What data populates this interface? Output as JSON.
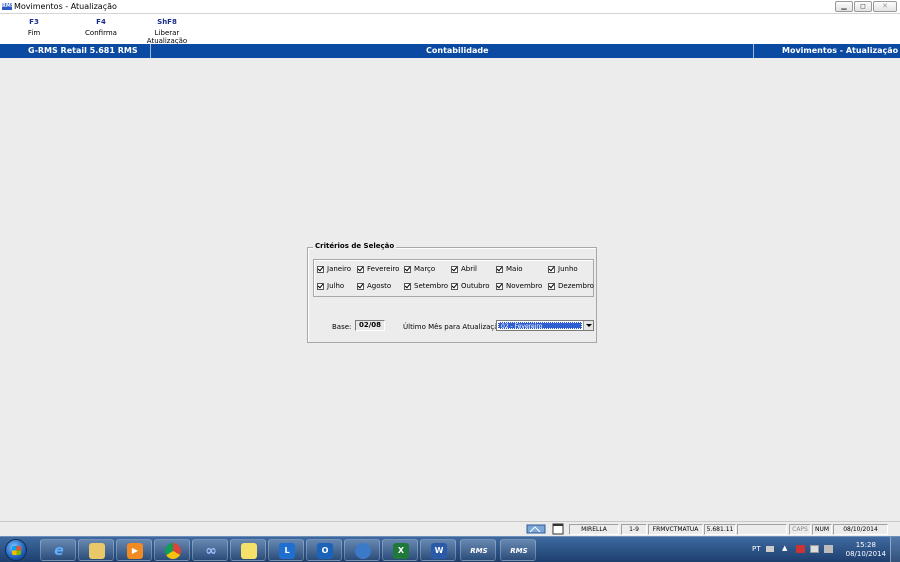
{
  "window": {
    "title": "Movimentos - Atualização",
    "icon_text": "RMS",
    "controls": [
      "minimize",
      "maximize",
      "close"
    ]
  },
  "fkeys": [
    {
      "key": "F3",
      "label": "Fim"
    },
    {
      "key": "F4",
      "label": "Confirma"
    },
    {
      "key": "ShF8",
      "label": "Liberar Atualização"
    }
  ],
  "header": {
    "left": "G-RMS Retail 5.681 RMS",
    "center": "Contabilidade",
    "right": "Movimentos - Atualização"
  },
  "criteria": {
    "title": "Critérios de Seleção",
    "months": [
      {
        "label": "Janeiro",
        "checked": true
      },
      {
        "label": "Fevereiro",
        "checked": true
      },
      {
        "label": "Março",
        "checked": true
      },
      {
        "label": "Abril",
        "checked": true
      },
      {
        "label": "Maio",
        "checked": true
      },
      {
        "label": "Junho",
        "checked": true
      },
      {
        "label": "Julho",
        "checked": true
      },
      {
        "label": "Agosto",
        "checked": true
      },
      {
        "label": "Setembro",
        "checked": true
      },
      {
        "label": "Outubro",
        "checked": true
      },
      {
        "label": "Novembro",
        "checked": true
      },
      {
        "label": "Dezembro",
        "checked": true
      }
    ],
    "base_label": "Base:",
    "base_value": "02/08",
    "ultimo_label": "Último Mês para Atualização:",
    "ultimo_value": "02 - Fevereiro"
  },
  "statusbar": {
    "user": "MIRELLA",
    "range": "1-9",
    "form": "FRMVCTMATUA",
    "version": "5.681.11",
    "empty": "",
    "caps": "CAPS",
    "num": "NUM",
    "date": "08/10/2014"
  },
  "taskbar": {
    "apps": [
      {
        "name": "internet-explorer",
        "glyph": "e",
        "color": "#1e88e5"
      },
      {
        "name": "file-explorer",
        "glyph": "",
        "color": "#e9c86a"
      },
      {
        "name": "media-player",
        "glyph": "▶",
        "color": "#f08a24"
      },
      {
        "name": "chrome",
        "glyph": "",
        "color": "#db4437"
      },
      {
        "name": "app-infinity",
        "glyph": "∞",
        "color": "#3a5fb0"
      },
      {
        "name": "sticky-notes",
        "glyph": "",
        "color": "#f5e06a"
      },
      {
        "name": "lync",
        "glyph": "L",
        "color": "#1f6fd0"
      },
      {
        "name": "outlook",
        "glyph": "O",
        "color": "#1b63b8"
      },
      {
        "name": "remote-app",
        "glyph": "",
        "color": "#3c79c8"
      },
      {
        "name": "excel",
        "glyph": "X",
        "color": "#1f7a3a"
      },
      {
        "name": "word",
        "glyph": "W",
        "color": "#2b5aa8"
      },
      {
        "name": "rms-1",
        "text": "RMS"
      },
      {
        "name": "rms-2",
        "text": "RMS"
      }
    ],
    "lang": "PT",
    "time": "15:28",
    "date": "08/10/2014"
  }
}
